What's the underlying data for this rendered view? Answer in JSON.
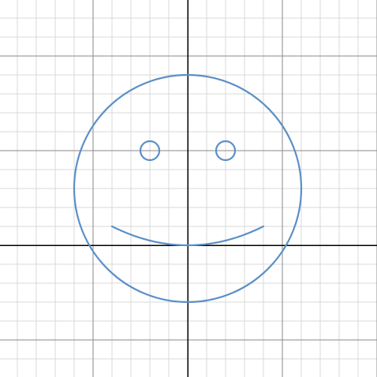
{
  "chart_data": {
    "type": "line",
    "title": "",
    "xlabel": "",
    "ylabel": "",
    "grid": true,
    "minor_grid": true,
    "xlim": [
      -9.9167,
      10
    ],
    "ylim": [
      -6.9583,
      12.9583
    ],
    "major_step": 5,
    "minor_step": 1,
    "colors": {
      "curve": "#5b8fc7",
      "axis": "#000000",
      "major_grid": "#8a8a8a",
      "minor_grid": "#d9d9d9",
      "background": "#ffffff"
    },
    "series": [
      {
        "shape": "circle",
        "center": [
          0,
          3
        ],
        "radius": 6
      },
      {
        "shape": "circle",
        "center": [
          -2,
          5
        ],
        "radius": 0.5
      },
      {
        "shape": "circle",
        "center": [
          2,
          5
        ],
        "radius": 0.5
      },
      {
        "shape": "parabola",
        "equation": "y = x^2 / 16",
        "domain": [
          -4,
          4
        ]
      }
    ]
  }
}
